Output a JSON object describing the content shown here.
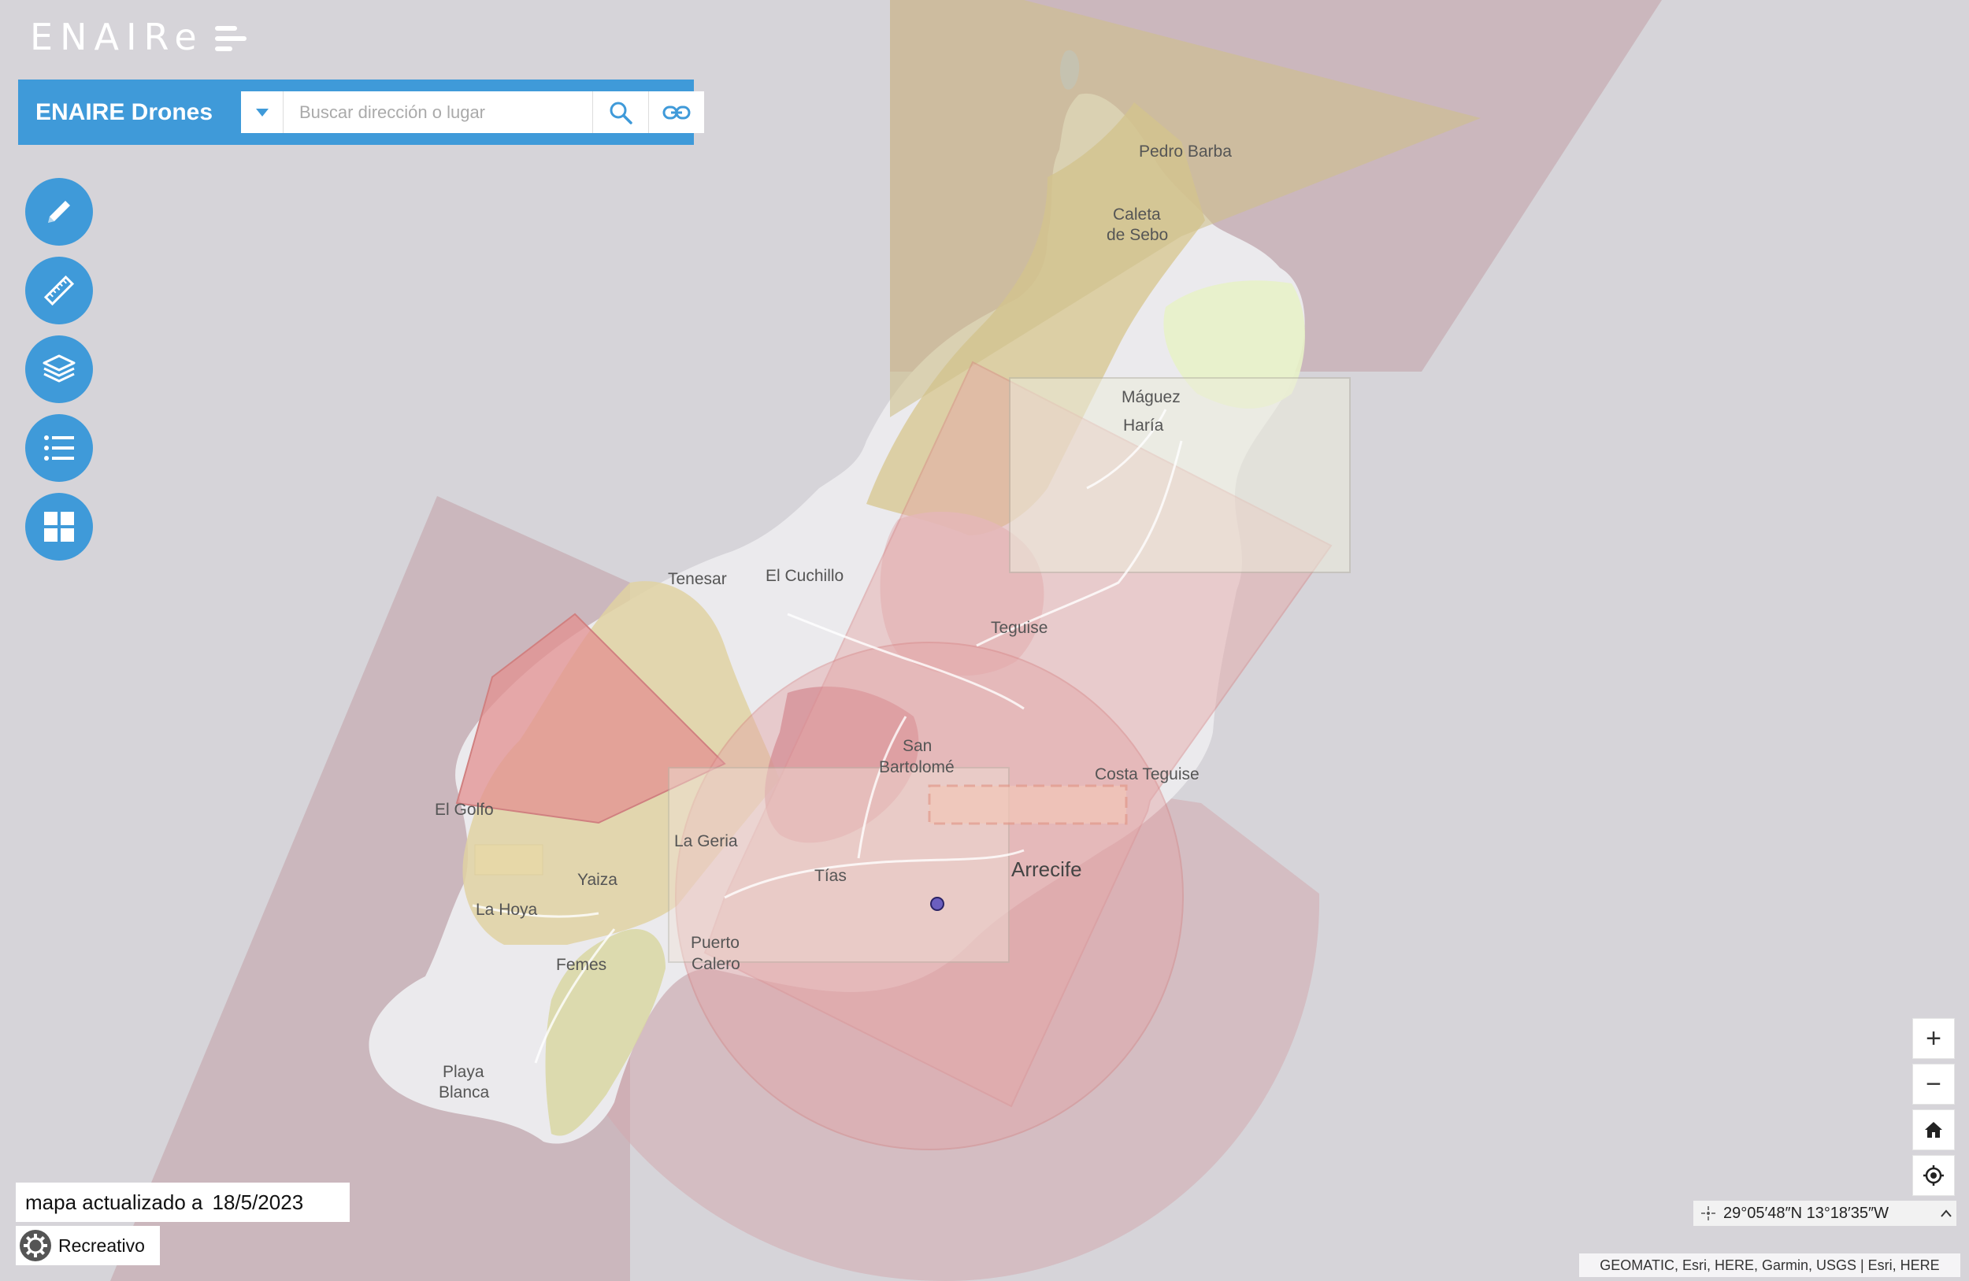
{
  "logo": {
    "text": "ENAIRe"
  },
  "search": {
    "title": "ENAIRE Drones",
    "placeholder": "Buscar dirección o lugar"
  },
  "tools": [
    {
      "icon": "pencil-icon"
    },
    {
      "icon": "ruler-icon"
    },
    {
      "icon": "layers-icon"
    },
    {
      "icon": "list-icon"
    },
    {
      "icon": "grid-icon"
    }
  ],
  "places": [
    "Pedro Barba",
    "Caleta",
    "de Sebo",
    "Máguez",
    "Haría",
    "Tenesar",
    "El Cuchillo",
    "Teguise",
    "San",
    "Bartolomé",
    "Costa Teguise",
    "El Golfo",
    "La Geria",
    "Yaiza",
    "Tías",
    "Arrecife",
    "La Hoya",
    "Puerto",
    "Calero",
    "Femes",
    "Playa",
    "Blanca"
  ],
  "zoom": {
    "in": "+",
    "out": "−"
  },
  "coordinates": "29°05′48″N 13°18′35″W",
  "attribution": "GEOMATIC, Esri, HERE, Garmin, USGS | Esri, HERE",
  "footer": {
    "updated_label": "mapa actualizado a",
    "updated_date": "18/5/2023",
    "mode": "Recreativo"
  },
  "colors": {
    "accent": "#3f9ad9",
    "zone_red": "#e07a7a",
    "zone_yellow": "#e8d08a",
    "zone_pink": "#c9a6ad"
  }
}
